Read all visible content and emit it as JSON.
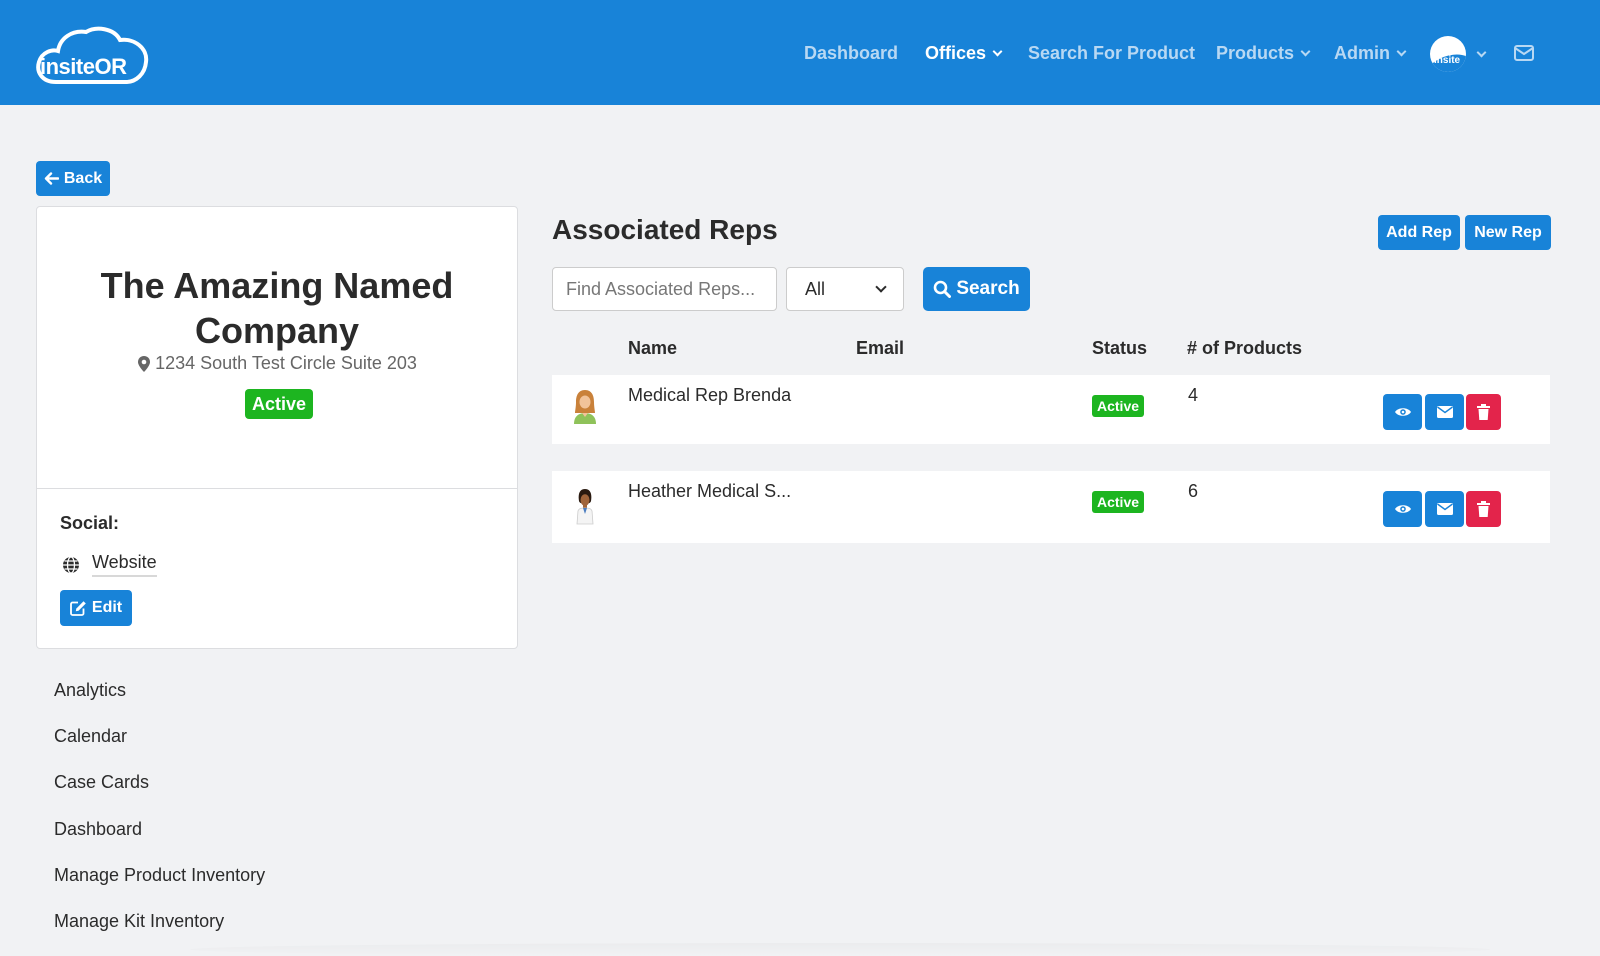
{
  "navbar": {
    "logo_text": "insiteOR",
    "links": [
      {
        "label": "Dashboard",
        "active": false,
        "dropdown": false
      },
      {
        "label": "Offices",
        "active": true,
        "dropdown": true
      },
      {
        "label": "Search For Product",
        "active": false,
        "dropdown": false
      },
      {
        "label": "Products",
        "active": false,
        "dropdown": true
      },
      {
        "label": "Admin",
        "active": false,
        "dropdown": true
      }
    ],
    "avatar_text": "insite",
    "icons": {
      "user_menu": "chevron-down-icon",
      "mail": "envelope-icon"
    },
    "color": "#1883d8"
  },
  "back_label": "Back",
  "office": {
    "name": "The Amazing Named Company",
    "address": "1234 South Test Circle Suite 203",
    "status": "Active",
    "social_label": "Social:",
    "website_label": "Website",
    "edit_label": "Edit"
  },
  "side_menu": [
    "Analytics",
    "Calendar",
    "Case Cards",
    "Dashboard",
    "Manage Product Inventory",
    "Manage Kit Inventory"
  ],
  "reps": {
    "title": "Associated Reps",
    "add_label": "Add Rep",
    "new_label": "New Rep",
    "search_placeholder": "Find Associated Reps...",
    "filter_value": "All",
    "search_label": "Search",
    "columns": [
      "Name",
      "Email",
      "Status",
      "# of Products"
    ],
    "rows": [
      {
        "name": "Medical Rep Brenda",
        "email": "",
        "status": "Active",
        "products": "4"
      },
      {
        "name": "Heather Medical S...",
        "email": "",
        "status": "Active",
        "products": "6"
      }
    ]
  },
  "colors": {
    "primary": "#1883d8",
    "success": "#1db520",
    "danger": "#e3244b",
    "background": "#f1f2f4"
  }
}
